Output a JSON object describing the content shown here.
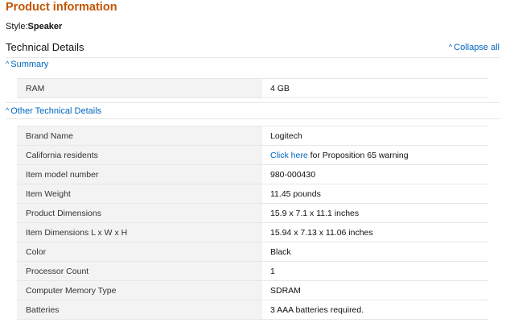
{
  "header": {
    "title": "Product information",
    "style_label": "Style:",
    "style_value": "Speaker"
  },
  "technical_details": {
    "title": "Technical Details",
    "collapse_all": "Collapse all",
    "summary": {
      "label": "Summary",
      "rows": [
        {
          "label": "RAM",
          "value": "4 GB"
        }
      ]
    },
    "other": {
      "label": "Other Technical Details",
      "rows": [
        {
          "label": "Brand Name",
          "value": "Logitech"
        },
        {
          "label": "California residents",
          "link": "Click here",
          "value": " for Proposition 65 warning"
        },
        {
          "label": "Item model number",
          "value": "980-000430"
        },
        {
          "label": "Item Weight",
          "value": "11.45 pounds"
        },
        {
          "label": "Product Dimensions",
          "value": "15.9 x 7.1 x 11.1 inches"
        },
        {
          "label": "Item Dimensions L x W x H",
          "value": "15.94 x 7.13 x 11.06 inches"
        },
        {
          "label": "Color",
          "value": "Black"
        },
        {
          "label": "Processor Count",
          "value": "1"
        },
        {
          "label": "Computer Memory Type",
          "value": "SDRAM"
        },
        {
          "label": "Batteries",
          "value": "3 AAA batteries required."
        }
      ]
    }
  },
  "colors": {
    "title": "#c45500",
    "link": "#0066c0",
    "label_bg": "#f3f3f3"
  }
}
